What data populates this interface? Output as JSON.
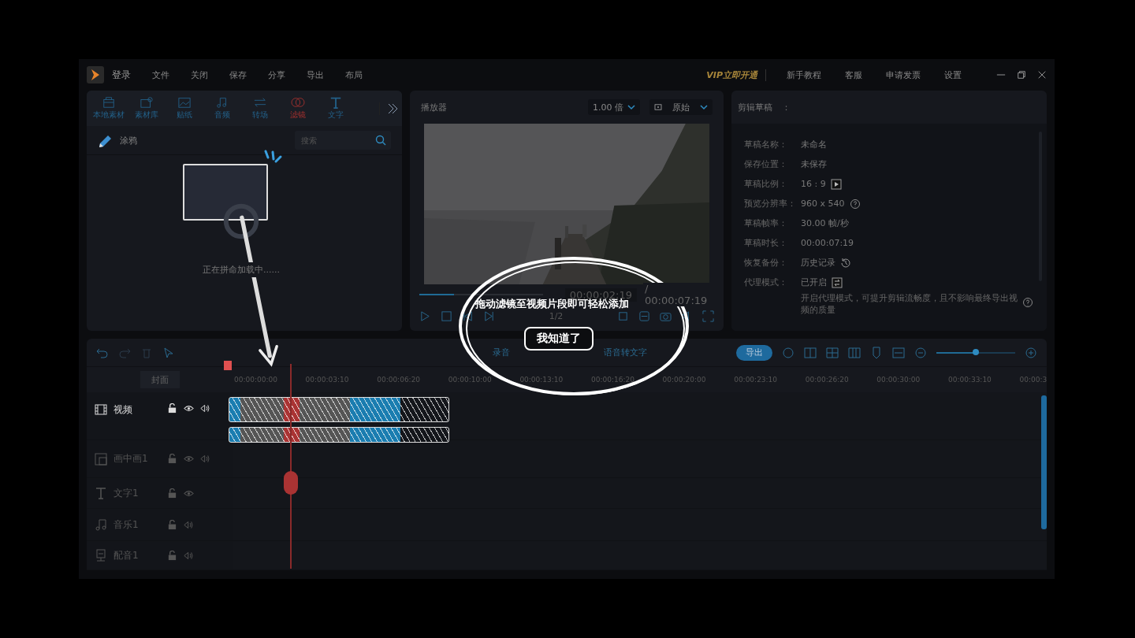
{
  "menu": {
    "login": "登录",
    "items": [
      "文件",
      "关闭",
      "保存",
      "分享",
      "导出",
      "布局"
    ],
    "vip": "VIP立即开通",
    "links": [
      "新手教程",
      "客服",
      "申请发票",
      "设置"
    ]
  },
  "media_tabs": [
    {
      "label": "本地素材",
      "kind": "folder",
      "selected": false
    },
    {
      "label": "素材库",
      "kind": "library",
      "selected": false
    },
    {
      "label": "贴纸",
      "kind": "sticker",
      "selected": false
    },
    {
      "label": "音频",
      "kind": "music",
      "selected": false
    },
    {
      "label": "转场",
      "kind": "transition",
      "selected": false
    },
    {
      "label": "滤镜",
      "kind": "filter",
      "selected": true
    },
    {
      "label": "文字",
      "kind": "text",
      "selected": false
    }
  ],
  "filter_panel": {
    "category": "涂鸦",
    "search": {
      "placeholder": "搜索"
    },
    "loading": "正在拼命加载中......"
  },
  "player": {
    "title": "播放器",
    "speed": "1.00 倍",
    "ratio": "原始",
    "current_time": "00:00:02:19",
    "total_time": "/ 00:00:07:19",
    "page": "1/2",
    "progress": {
      "level": 0.28
    }
  },
  "draft": {
    "title": "剪辑草稿",
    "separator": "：",
    "rows": [
      {
        "label": "草稿名称：",
        "value": "未命名"
      },
      {
        "label": "保存位置：",
        "value": "未保存"
      },
      {
        "label": "草稿比例：",
        "value": "16 : 9",
        "kind": "play"
      },
      {
        "label": "预览分辨率：",
        "value": "960 x 540",
        "kind": "help"
      },
      {
        "label": "草稿帧率：",
        "value": "30.00 帧/秒"
      },
      {
        "label": "草稿时长：",
        "value": "00:00:07:19"
      },
      {
        "label": "恢复备份：",
        "value": "历史记录",
        "kind": "history"
      },
      {
        "label": "代理模式：",
        "value": "已开启",
        "kind": "toggle"
      }
    ],
    "note": "开启代理模式，可提升剪辑流畅度，且不影响最终导出视频的质量"
  },
  "timeline": {
    "toolbar": {
      "record": "录音",
      "speech_to_text": "语音转文字",
      "export": "导出",
      "zoom": {
        "level": 0.5
      }
    },
    "cover": "封面",
    "ruler": [
      "00:00:00:00",
      "00:00:03:10",
      "00:00:06:20",
      "00:00:10:00",
      "00:00:13:10",
      "00:00:16:20",
      "00:00:20:00",
      "00:00:23:10",
      "00:00:26:20",
      "00:00:30:00",
      "00:00:33:10",
      "00:00:3"
    ],
    "tracks": [
      {
        "name": "视频",
        "kind": "video",
        "highlighted": true,
        "eye": true,
        "audio": true
      },
      {
        "name": "画中画1",
        "kind": "pip",
        "highlighted": false,
        "eye": true,
        "audio": true
      },
      {
        "name": "文字1",
        "kind": "text",
        "highlighted": false,
        "eye": true,
        "audio": false
      },
      {
        "name": "音乐1",
        "kind": "music",
        "highlighted": false,
        "eye": false,
        "audio": true
      },
      {
        "name": "配音1",
        "kind": "voice",
        "highlighted": false,
        "eye": false,
        "audio": true
      }
    ]
  },
  "hint": {
    "message": "拖动滤镜至视频片段即可轻松添加",
    "button": "我知道了"
  }
}
